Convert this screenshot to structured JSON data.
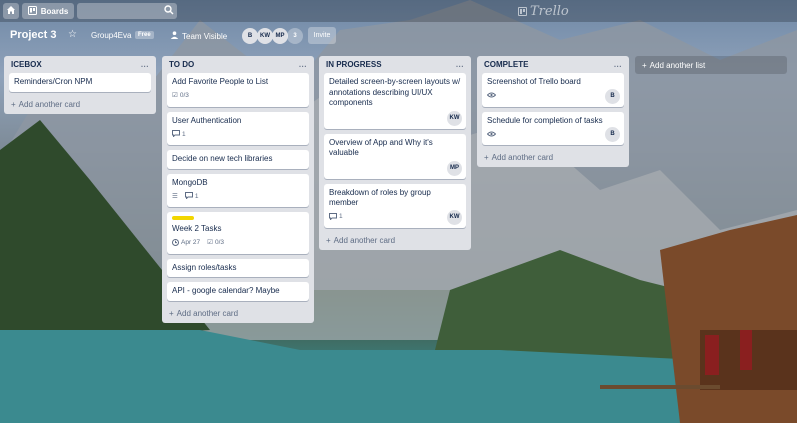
{
  "topbar": {
    "home_icon": "home-icon",
    "boards_label": "Boards",
    "search_icon": "search-icon",
    "logo_text": "Trello"
  },
  "board": {
    "title": "Project 3",
    "team": "Group4Eva",
    "team_badge": "Free",
    "visibility": "Team Visible",
    "members": [
      "B",
      "KW",
      "MP"
    ],
    "member_count": "3",
    "invite_label": "Invite"
  },
  "lists": {
    "icebox": {
      "title": "ICEBOX",
      "menu": "...",
      "cards": [
        {
          "title": "Reminders/Cron NPM"
        }
      ],
      "add_card": "Add another card"
    },
    "todo": {
      "title": "TO DO",
      "menu": "...",
      "cards": [
        {
          "title": "Add Favorite People to List",
          "checklist": "0/3"
        },
        {
          "title": "User Authentication",
          "comments": "1"
        },
        {
          "title": "Decide on new tech libraries"
        },
        {
          "title": "MongoDB",
          "comments": "1"
        },
        {
          "title": "Week 2 Tasks",
          "due": "Apr 27",
          "checklist": "0/3",
          "label_color": "#f2d600"
        },
        {
          "title": "Assign roles/tasks"
        },
        {
          "title": "API - google calendar? Maybe"
        }
      ],
      "add_card": "Add another card"
    },
    "inprogress": {
      "title": "IN PROGRESS",
      "menu": "...",
      "cards": [
        {
          "title": "Detailed screen-by-screen layouts w/ annotations describing UI/UX components",
          "member": "KW"
        },
        {
          "title": "Overview of App and Why it's valuable",
          "member": "MP"
        },
        {
          "title": "Breakdown of roles by group member",
          "comments": "1",
          "member": "KW"
        }
      ],
      "add_card": "Add another card"
    },
    "complete": {
      "title": "COMPLETE",
      "menu": "...",
      "cards": [
        {
          "title": "Screenshot of Trello board",
          "member": "B"
        },
        {
          "title": "Schedule for completion of tasks",
          "member": "B"
        }
      ],
      "add_card": "Add another card"
    }
  },
  "add_list_label": "Add another list",
  "colors": {
    "list_bg": "#dfe1e6",
    "card_text": "#172b4d",
    "muted_text": "#5e6c84",
    "label_yellow": "#f2d600"
  }
}
